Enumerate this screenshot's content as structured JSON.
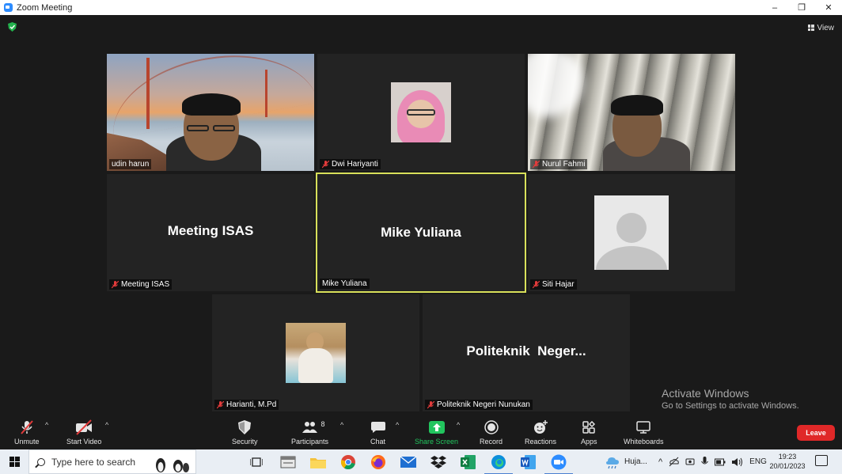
{
  "window": {
    "title": "Zoom Meeting",
    "controls": [
      "–",
      "❐",
      "✕"
    ]
  },
  "view_button": {
    "label": "View"
  },
  "participants": [
    {
      "name": "udin harun",
      "muted": false,
      "type": "video"
    },
    {
      "name": "Dwi Hariyanti",
      "muted": true,
      "type": "photo"
    },
    {
      "name": "Nurul Fahmi",
      "muted": true,
      "type": "video"
    },
    {
      "name": "Meeting ISAS",
      "display": "Meeting ISAS",
      "muted": true,
      "type": "name"
    },
    {
      "name": "Mike Yuliana",
      "display": "Mike Yuliana",
      "muted": false,
      "type": "name",
      "active_speaker": true
    },
    {
      "name": "Siti Hajar",
      "muted": true,
      "type": "avatar"
    },
    {
      "name": "Harianti, M.Pd",
      "muted": true,
      "type": "photo"
    },
    {
      "name": "Politeknik Negeri Nunukan",
      "display": "Politeknik  Neger...",
      "muted": true,
      "type": "name"
    }
  ],
  "watermark": {
    "line1": "Activate Windows",
    "line2": "Go to Settings to activate Windows."
  },
  "toolbar": {
    "unmute": "Unmute",
    "start_video": "Start Video",
    "security": "Security",
    "participants": "Participants",
    "participants_count": "8",
    "chat": "Chat",
    "share_screen": "Share Screen",
    "record": "Record",
    "reactions": "Reactions",
    "apps": "Apps",
    "whiteboards": "Whiteboards",
    "leave": "Leave"
  },
  "taskbar": {
    "search_placeholder": "Type here to search",
    "weather": "Huja...",
    "language": "ENG",
    "time": "19:23",
    "date": "20/01/2023"
  },
  "colors": {
    "active_border": "#d8e05a",
    "share_green": "#22c55e",
    "leave_red": "#e02828",
    "zoom_blue": "#2d8cff"
  }
}
